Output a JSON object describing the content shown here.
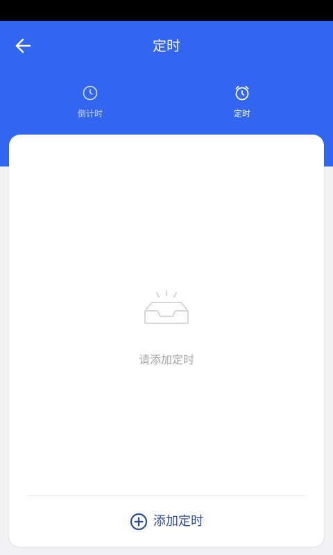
{
  "header": {
    "title": "定时",
    "back_icon": "arrow-left-icon"
  },
  "tabs": [
    {
      "label": "倒计时",
      "icon": "clock-icon",
      "active": false
    },
    {
      "label": "定时",
      "icon": "alarm-clock-icon",
      "active": true
    }
  ],
  "empty_state": {
    "icon": "empty-inbox-icon",
    "message": "请添加定时"
  },
  "add_button": {
    "icon": "plus-circle-icon",
    "label": "添加定时"
  },
  "colors": {
    "header_bg": "#3366f0",
    "page_bg": "#f2f2f4",
    "accent": "#2c4a8c",
    "muted_text": "#a6a6a6"
  }
}
